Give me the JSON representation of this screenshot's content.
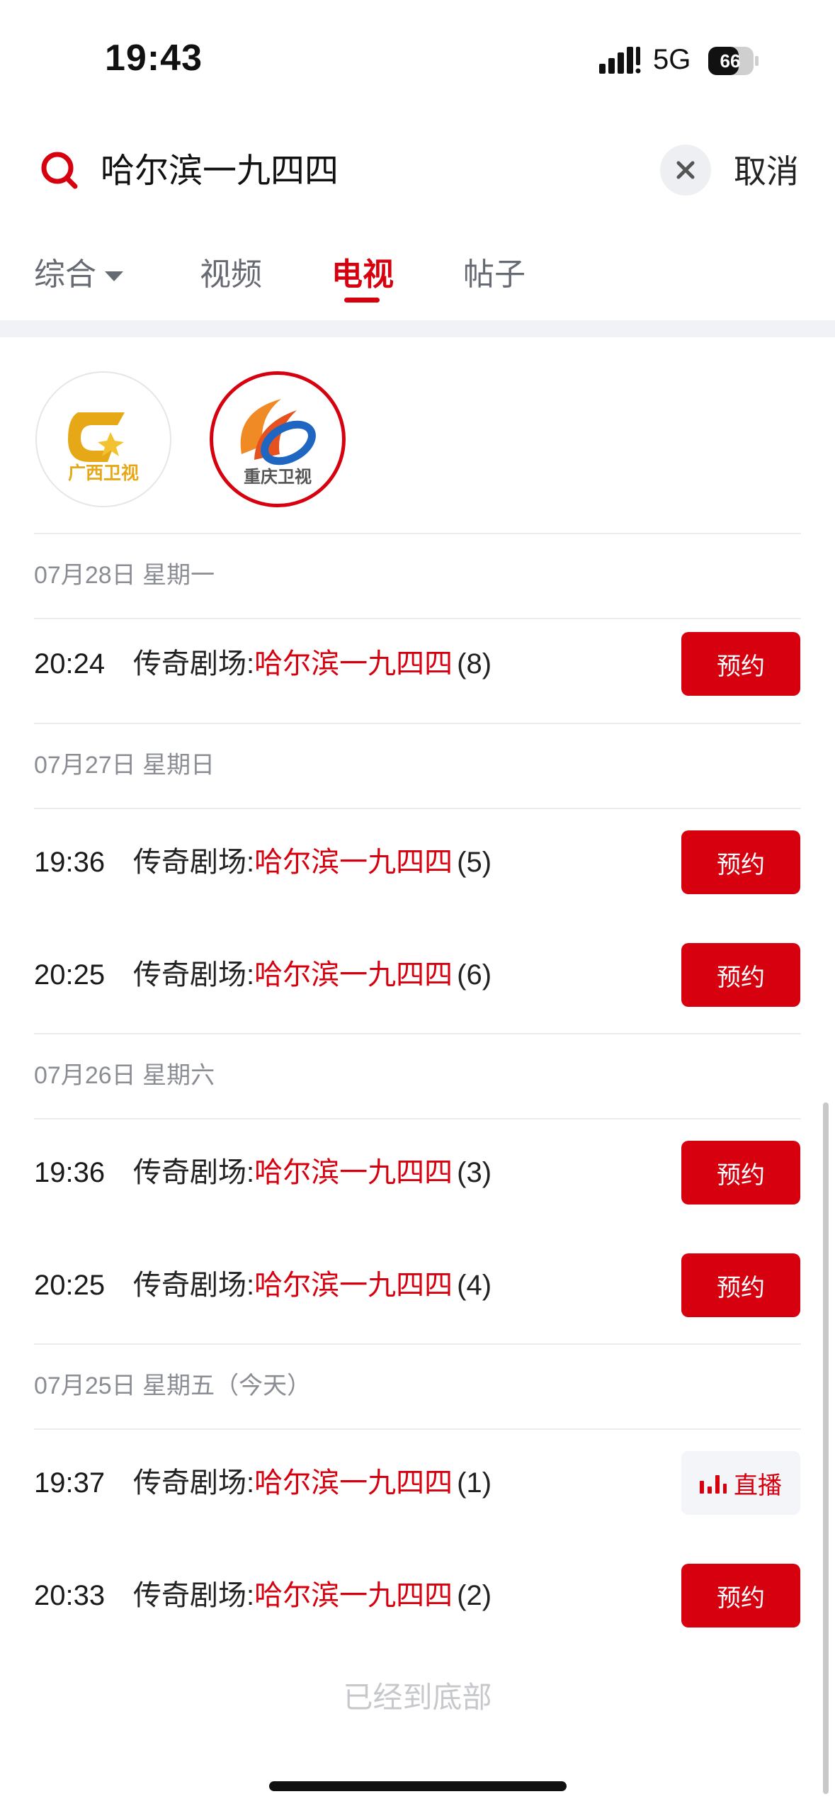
{
  "status_bar": {
    "time": "19:43",
    "network": "5G",
    "battery": "66"
  },
  "search": {
    "query": "哈尔滨一九四四",
    "cancel_label": "取消"
  },
  "tabs": [
    {
      "label": "综合"
    },
    {
      "label": "视频"
    },
    {
      "label": "电视"
    },
    {
      "label": "帖子"
    }
  ],
  "active_tab": "电视",
  "channels": [
    {
      "name": "广西卫视"
    },
    {
      "name": "重庆卫视"
    }
  ],
  "schedule": [
    {
      "date": "07月28日 星期一",
      "items": [
        {
          "time": "20:24",
          "prefix": "传奇剧场:",
          "name": "哈尔滨一九四四",
          "episode": "(8)",
          "action": "预约"
        }
      ]
    },
    {
      "date": "07月27日 星期日",
      "items": [
        {
          "time": "19:36",
          "prefix": "传奇剧场:",
          "name": "哈尔滨一九四四",
          "episode": "(5)",
          "action": "预约"
        },
        {
          "time": "20:25",
          "prefix": "传奇剧场:",
          "name": "哈尔滨一九四四",
          "episode": "(6)",
          "action": "预约"
        }
      ]
    },
    {
      "date": "07月26日 星期六",
      "items": [
        {
          "time": "19:36",
          "prefix": "传奇剧场:",
          "name": "哈尔滨一九四四",
          "episode": "(3)",
          "action": "预约"
        },
        {
          "time": "20:25",
          "prefix": "传奇剧场:",
          "name": "哈尔滨一九四四",
          "episode": "(4)",
          "action": "预约"
        }
      ]
    },
    {
      "date": "07月25日 星期五（今天）",
      "items": [
        {
          "time": "19:37",
          "prefix": "传奇剧场:",
          "name": "哈尔滨一九四四",
          "episode": "(1)",
          "action": "直播"
        },
        {
          "time": "20:33",
          "prefix": "传奇剧场:",
          "name": "哈尔滨一九四四",
          "episode": "(2)",
          "action": "预约"
        }
      ]
    }
  ],
  "bottom_text": "已经到底部",
  "colors": {
    "accent": "#d7000f",
    "muted": "#8a8d93",
    "tab_inactive": "#666a73"
  },
  "icons": {
    "search": "search-icon",
    "clear": "close-icon",
    "dropdown": "caret-down-icon",
    "live": "live-bars-icon",
    "signal": "cellular-signal-icon",
    "battery": "battery-icon"
  }
}
